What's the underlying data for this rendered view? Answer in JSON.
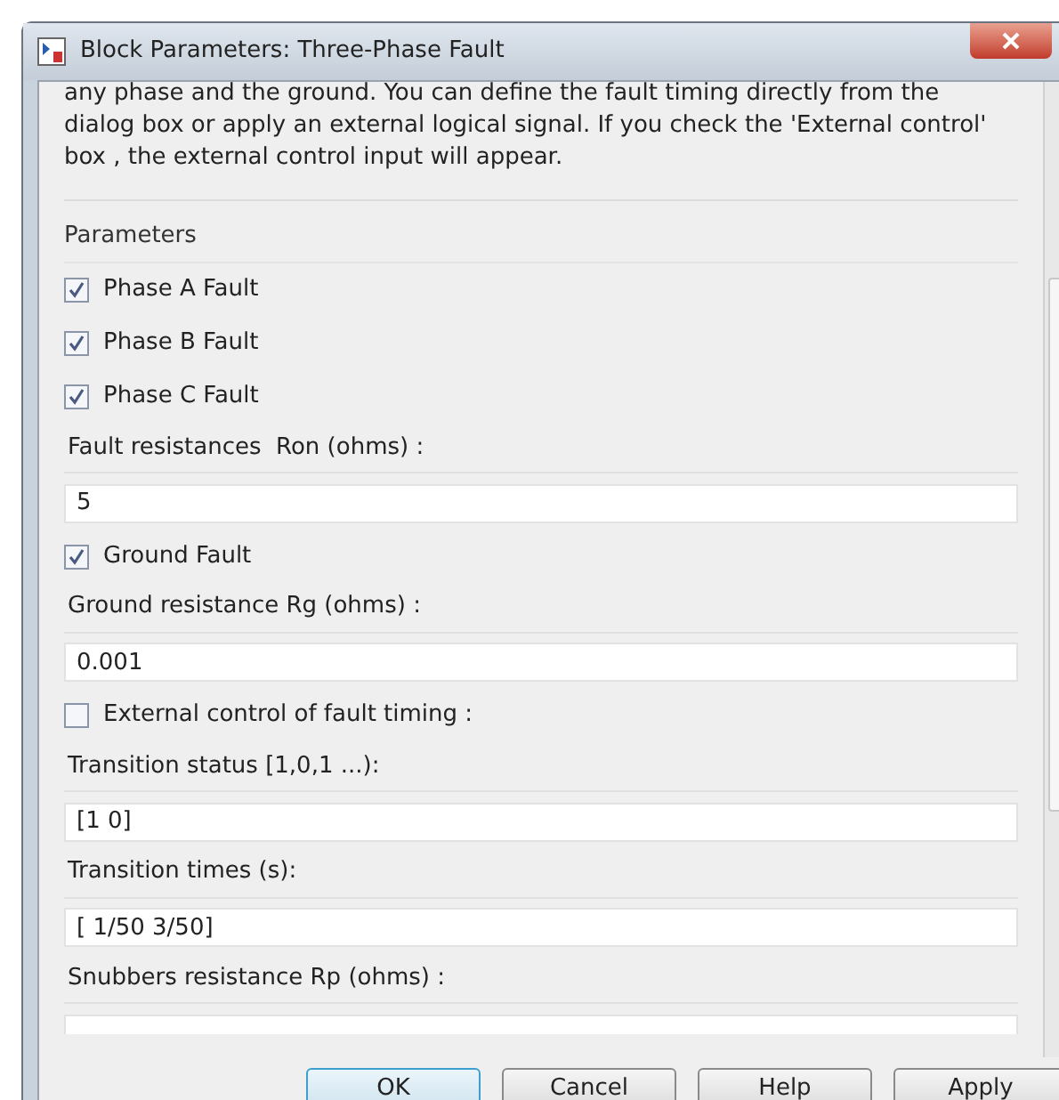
{
  "window": {
    "title": "Block Parameters: Three-Phase Fault"
  },
  "description": "any phase and the ground. You can define the fault timing directly from the dialog box or apply an external logical signal. If you check the 'External control' box , the external control input will appear.",
  "section": "Parameters",
  "items": [
    {
      "kind": "checkbox",
      "label": "Phase A Fault",
      "checked": true
    },
    {
      "kind": "checkbox",
      "label": "Phase B Fault",
      "checked": true
    },
    {
      "kind": "checkbox",
      "label": "Phase C Fault",
      "checked": true
    },
    {
      "kind": "label",
      "label": "Fault resistances  Ron (ohms) :"
    },
    {
      "kind": "field",
      "value": "5"
    },
    {
      "kind": "checkbox",
      "label": "Ground Fault",
      "checked": true
    },
    {
      "kind": "label",
      "label": "Ground resistance Rg (ohms) :"
    },
    {
      "kind": "field",
      "value": "0.001"
    },
    {
      "kind": "checkbox",
      "label": "External control of fault timing :",
      "checked": false
    },
    {
      "kind": "label",
      "label": "Transition status [1,0,1 ...):"
    },
    {
      "kind": "field",
      "value": "[1 0]"
    },
    {
      "kind": "label",
      "label": "Transition times (s):"
    },
    {
      "kind": "field",
      "value": "[ 1/50 3/50]"
    },
    {
      "kind": "label",
      "label": "Snubbers resistance Rp (ohms) :"
    },
    {
      "kind": "field"
    }
  ],
  "buttons": [
    {
      "label": "OK",
      "selected": true
    },
    {
      "label": "Cancel",
      "selected": false
    },
    {
      "label": "Help",
      "selected": false
    },
    {
      "label": "Apply",
      "selected": false
    }
  ]
}
